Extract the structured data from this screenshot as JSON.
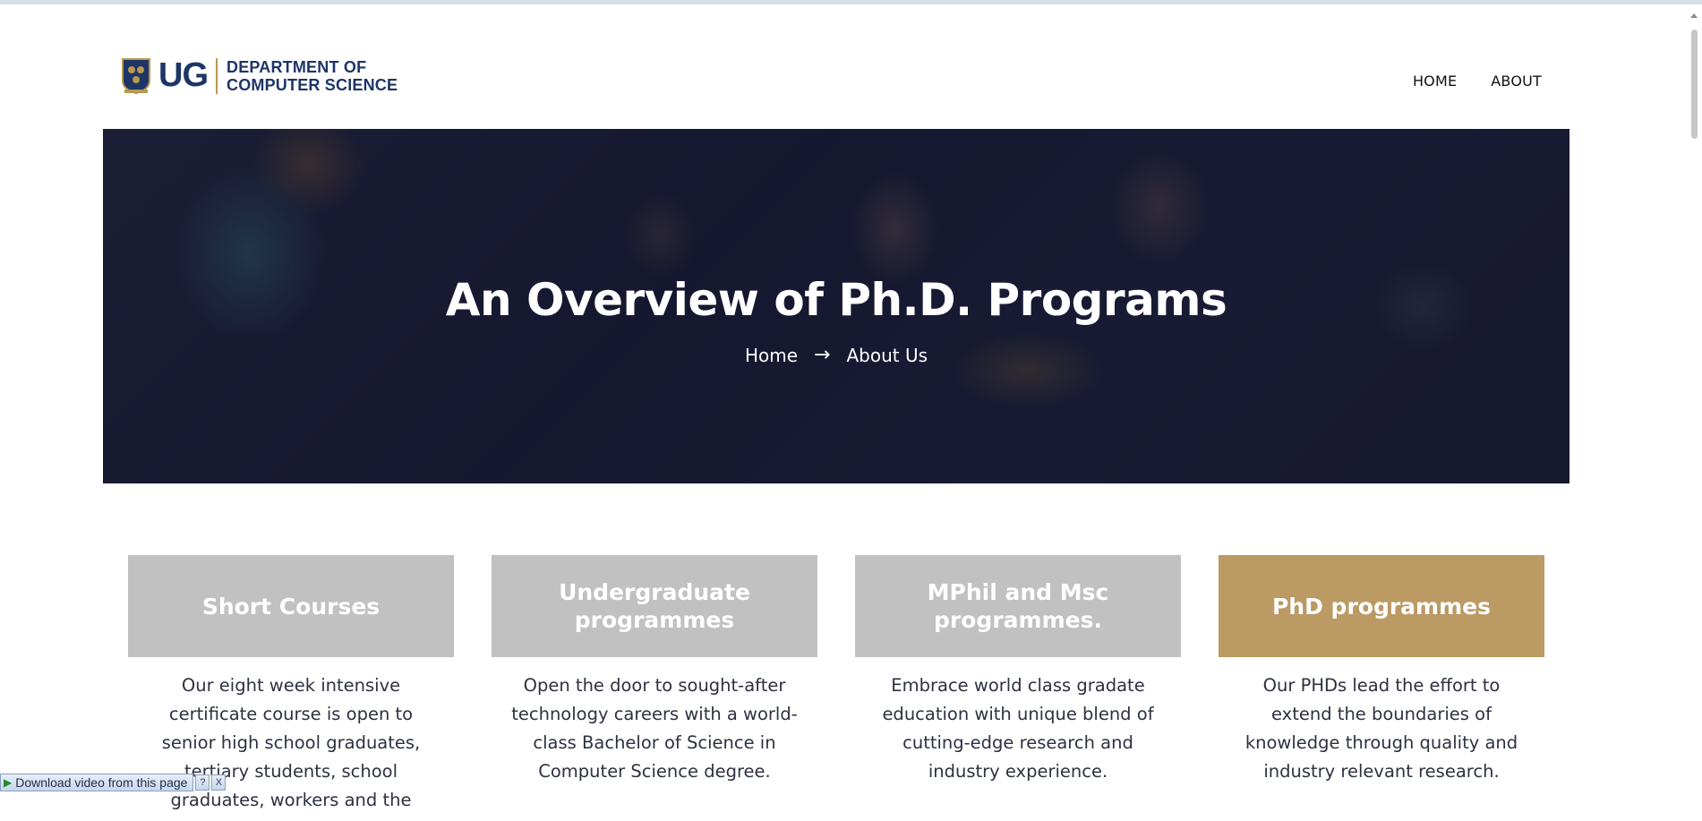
{
  "header": {
    "logo_ug": "UG",
    "logo_dept_line1": "DEPARTMENT OF",
    "logo_dept_line2": "COMPUTER SCIENCE",
    "nav": [
      {
        "label": "HOME"
      },
      {
        "label": "ABOUT"
      }
    ]
  },
  "hero": {
    "title": "An Overview of Ph.D. Programs",
    "breadcrumb_home": "Home",
    "breadcrumb_arrow": "→",
    "breadcrumb_current": "About Us"
  },
  "cards": [
    {
      "title": "Short Courses",
      "text": "Our eight week intensive certificate course is open to senior high school graduates, tertiary students, school graduates, workers and the",
      "active": false
    },
    {
      "title": "Undergraduate programmes",
      "text": "Open the door to sought-after technology careers with a world-class Bachelor of Science in Computer Science degree.",
      "active": false
    },
    {
      "title": "MPhil and Msc programmes.",
      "text": "Embrace world class gradate education with unique blend of cutting-edge research and industry experience.",
      "active": false
    },
    {
      "title": "PhD programmes",
      "text": "Our PHDs lead the effort to extend the boundaries of knowledge through quality and industry relevant research.",
      "active": true
    }
  ],
  "download_bar": {
    "label": "Download video from this page",
    "help": "?",
    "close": "X"
  },
  "colors": {
    "brand_blue": "#1d3567",
    "gold": "#bb9a63",
    "card_grey": "#c1c1c1"
  }
}
